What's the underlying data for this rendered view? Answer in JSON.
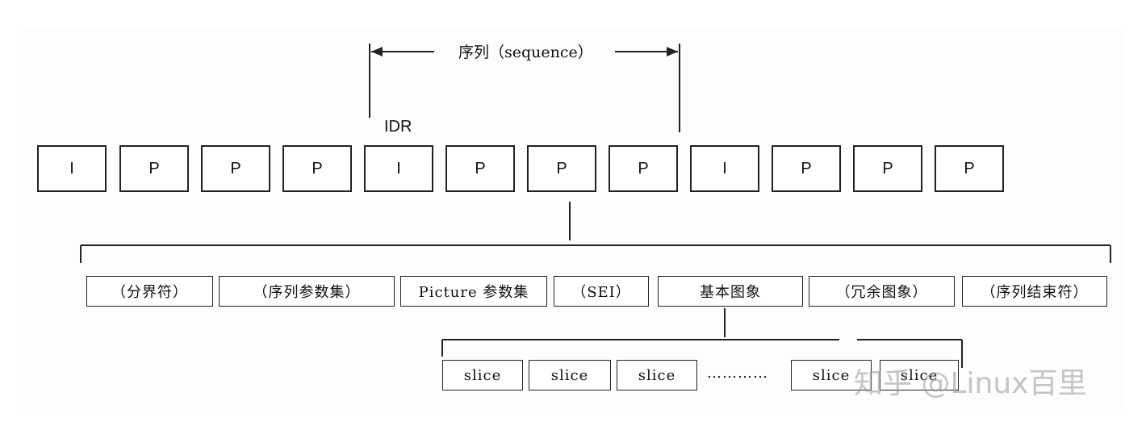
{
  "sequence_label": "序列（sequence）",
  "idr_label": "IDR",
  "frames": [
    "I",
    "P",
    "P",
    "P",
    "I",
    "P",
    "P",
    "P",
    "I",
    "P",
    "P",
    "P"
  ],
  "nal_units": [
    "（分界符）",
    "（序列参数集）",
    "Picture 参数集",
    "（SEI）",
    "基本图象",
    "（冗余图象）",
    "（序列结束符）"
  ],
  "slices": [
    "slice",
    "slice",
    "slice",
    "slice",
    "slice"
  ],
  "slice_ellipsis": "…………",
  "watermark": "知乎 @Linux百里"
}
